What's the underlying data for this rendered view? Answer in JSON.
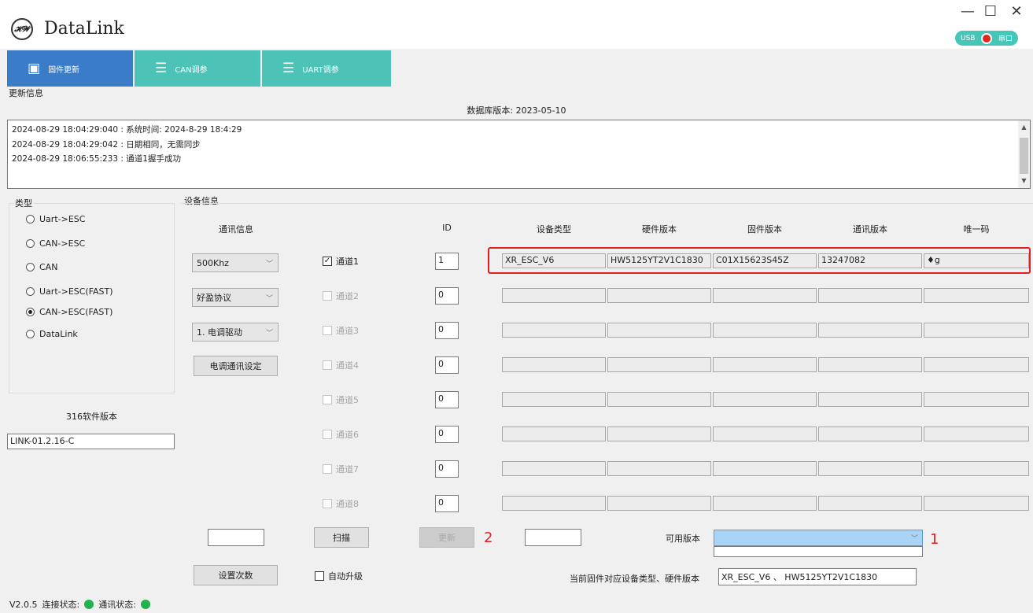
{
  "app": {
    "title": "DataLink"
  },
  "window": {
    "minimize": "—",
    "maximize": "☐",
    "close": "✕"
  },
  "toggle": {
    "left": "USB",
    "right": "串口"
  },
  "tabs": [
    {
      "label": "固件更新",
      "icon": "chip-icon",
      "color": "#3a7cc7"
    },
    {
      "label": "CAN调参",
      "icon": "checklist-icon",
      "color": "#4dc3b8"
    },
    {
      "label": "UART调参",
      "icon": "checklist-icon",
      "color": "#4dc3b8"
    }
  ],
  "update_info": {
    "label": "更新信息",
    "db_version": "数据库版本: 2023-05-10",
    "log_lines": [
      "2024-08-29 18:04:29:040 : 系统时间: 2024-8-29 18:4:29",
      "2024-08-29 18:04:29:042 : 日期相同，无需同步",
      "2024-08-29 18:06:55:233 : 通道1握手成功"
    ]
  },
  "type_group": {
    "label": "类型",
    "options": [
      "Uart->ESC",
      "CAN->ESC",
      "CAN",
      "Uart->ESC(FAST)",
      "CAN->ESC(FAST)",
      "DataLink"
    ],
    "selected": "CAN->ESC(FAST)"
  },
  "software": {
    "label": "316软件版本",
    "value": "LINK-01.2.16-C"
  },
  "device_info": {
    "label": "设备信息",
    "headers": {
      "comm": "通讯信息",
      "id": "ID",
      "type": "设备类型",
      "hw": "硬件版本",
      "fw": "固件版本",
      "comm_ver": "通讯版本",
      "uid": "唯一码"
    },
    "combos": [
      "500Khz",
      "好盈协议",
      "1. 电调驱动"
    ],
    "esc_comm_button": "电调通讯设定",
    "channels": [
      {
        "label": "通道1",
        "checked": true,
        "enabled": true,
        "id": "1",
        "type": "XR_ESC_V6",
        "hw": "HW5125YT2V1C1830",
        "fw": "C01X15623S45Z",
        "comm_ver": "13247082",
        "uid": "♦g"
      },
      {
        "label": "通道2",
        "checked": false,
        "enabled": false,
        "id": "0",
        "type": "",
        "hw": "",
        "fw": "",
        "comm_ver": "",
        "uid": ""
      },
      {
        "label": "通道3",
        "checked": false,
        "enabled": false,
        "id": "0",
        "type": "",
        "hw": "",
        "fw": "",
        "comm_ver": "",
        "uid": ""
      },
      {
        "label": "通道4",
        "checked": false,
        "enabled": false,
        "id": "0",
        "type": "",
        "hw": "",
        "fw": "",
        "comm_ver": "",
        "uid": ""
      },
      {
        "label": "通道5",
        "checked": false,
        "enabled": false,
        "id": "0",
        "type": "",
        "hw": "",
        "fw": "",
        "comm_ver": "",
        "uid": ""
      },
      {
        "label": "通道6",
        "checked": false,
        "enabled": false,
        "id": "0",
        "type": "",
        "hw": "",
        "fw": "",
        "comm_ver": "",
        "uid": ""
      },
      {
        "label": "通道7",
        "checked": false,
        "enabled": false,
        "id": "0",
        "type": "",
        "hw": "",
        "fw": "",
        "comm_ver": "",
        "uid": ""
      },
      {
        "label": "通道8",
        "checked": false,
        "enabled": false,
        "id": "0",
        "type": "",
        "hw": "",
        "fw": "",
        "comm_ver": "",
        "uid": ""
      }
    ]
  },
  "actions": {
    "scan": "扫描",
    "update": "更新",
    "set_count": "设置次数",
    "auto_upgrade": "自动升级",
    "available_version_label": "可用版本",
    "current_fw_label": "当前固件对应设备类型、硬件版本",
    "current_fw_value": "XR_ESC_V6 、 HW5125YT2V1C1830"
  },
  "annotations": {
    "one": "1",
    "two": "2"
  },
  "status": {
    "version": "V2.0.5",
    "connect": "连接状态:",
    "comm": "通讯状态:"
  }
}
